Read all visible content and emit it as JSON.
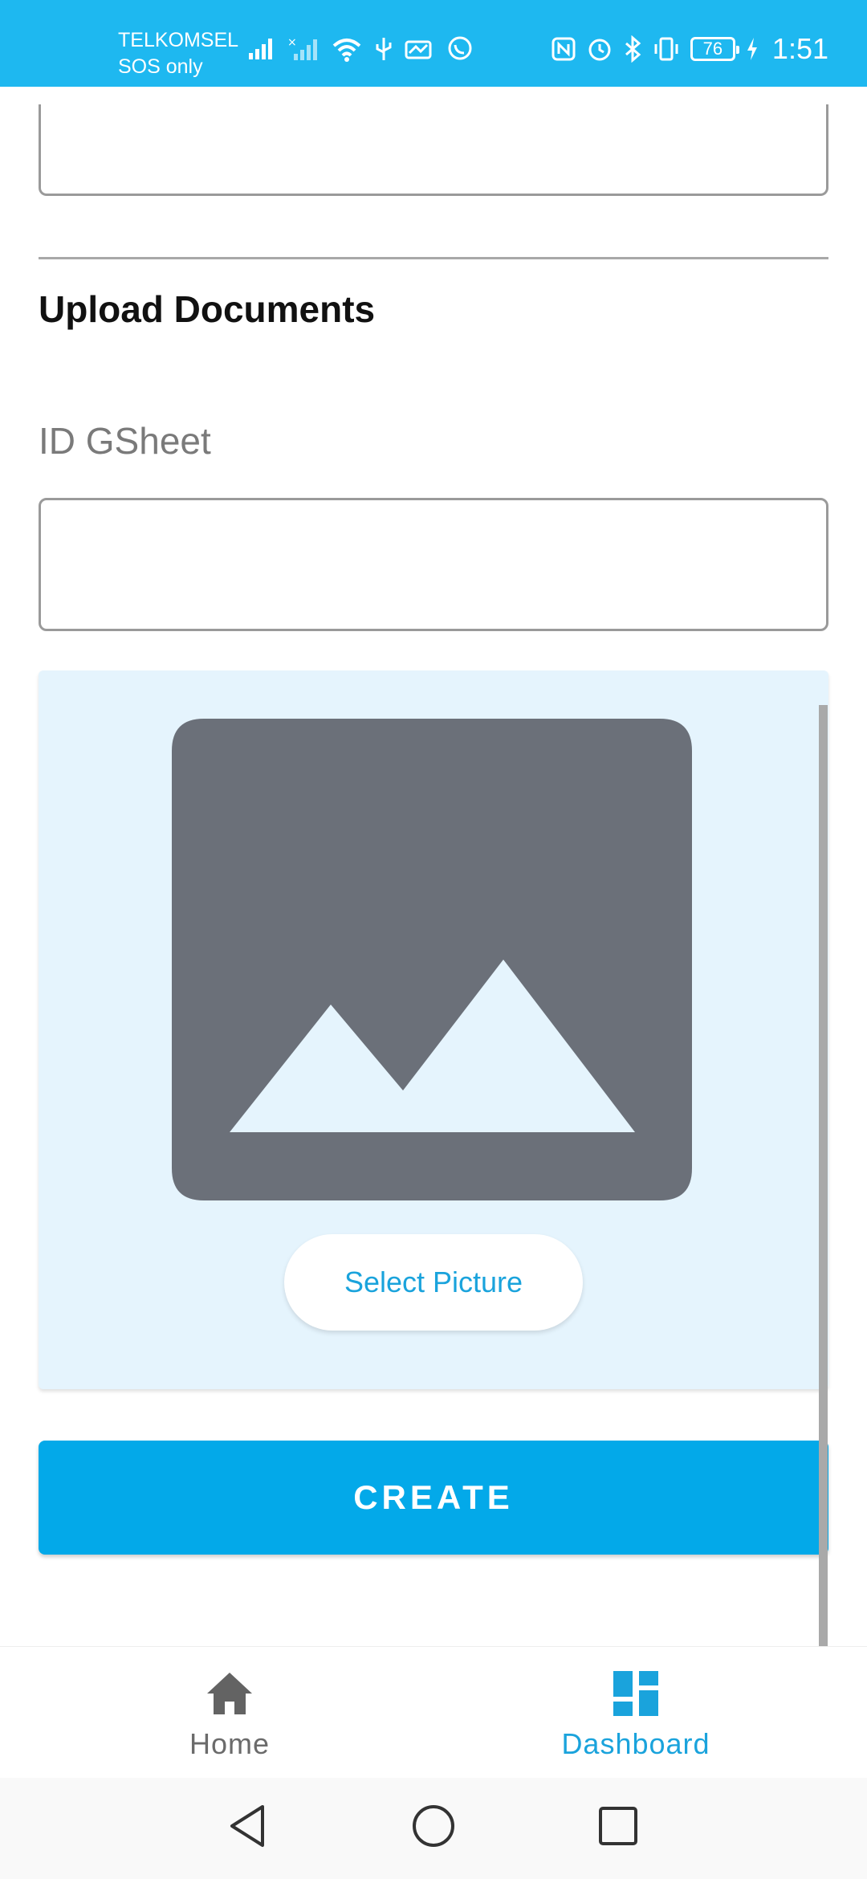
{
  "status_bar": {
    "carrier_line1": "TELKOMSEL",
    "carrier_line2": "SOS only",
    "battery": "76",
    "time": "1:51",
    "bg_color": "#1eb8f0"
  },
  "form": {
    "section_title": "Upload Documents",
    "id_gsheet_label": "ID GSheet",
    "id_gsheet_value": "",
    "select_picture_label": "Select Picture",
    "create_label": "CREATE",
    "accent_color": "#03a9e9"
  },
  "bottom_nav": {
    "items": [
      {
        "label": "Home",
        "icon": "home-icon"
      },
      {
        "label": "Dashboard",
        "icon": "dashboard-icon",
        "active": true
      }
    ]
  },
  "system_nav": {
    "icons": [
      "back-icon",
      "home-circle-icon",
      "recents-icon"
    ]
  }
}
